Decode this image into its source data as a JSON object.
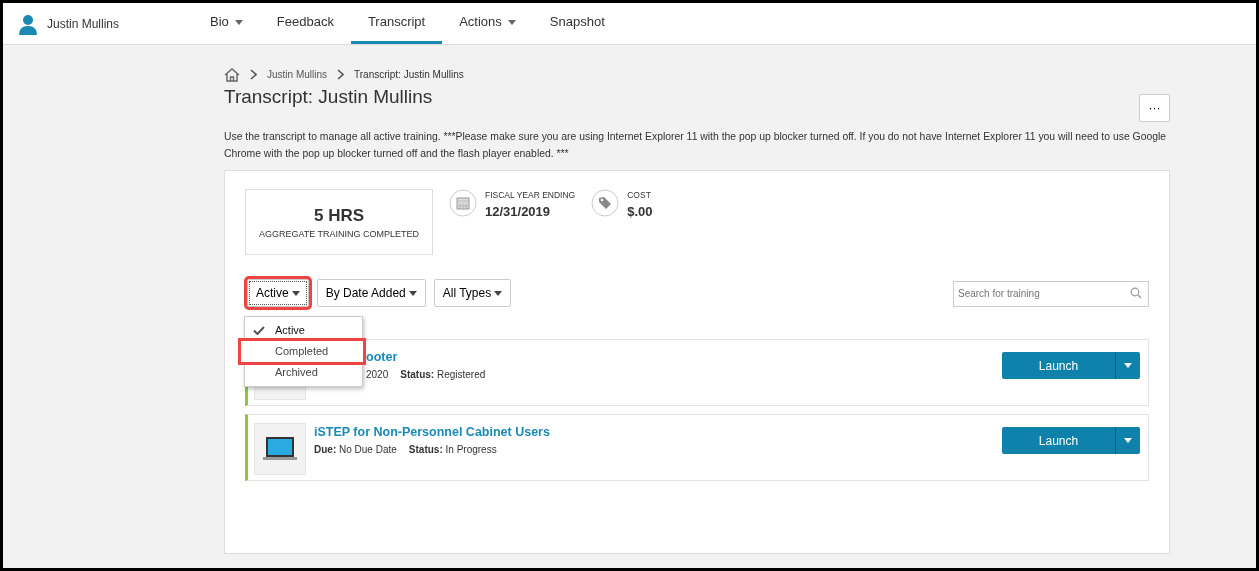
{
  "user": {
    "name": "Justin Mullins"
  },
  "nav": [
    {
      "label": "Bio",
      "dropdown": true,
      "selected": false
    },
    {
      "label": "Feedback",
      "dropdown": false,
      "selected": false
    },
    {
      "label": "Transcript",
      "dropdown": false,
      "selected": true
    },
    {
      "label": "Actions",
      "dropdown": true,
      "selected": false
    },
    {
      "label": "Snapshot",
      "dropdown": false,
      "selected": false
    }
  ],
  "breadcrumb": [
    "Justin Mullins",
    "Transcript: Justin Mullins"
  ],
  "title": "Transcript: Justin Mullins",
  "more_button": "···",
  "description": "Use the transcript to manage all active training. ***Please make sure you are using Internet Explorer 11 with the pop up blocker turned off. If you do not have Internet Explorer 11 you will need to use Google Chrome with the pop up blocker turned off and the flash player enabled. ***",
  "summary": {
    "value": "5 HRS",
    "label": "AGGREGATE TRAINING COMPLETED"
  },
  "stats": [
    {
      "kind": "calendar",
      "label": "FISCAL YEAR ENDING",
      "value": "12/31/2019"
    },
    {
      "kind": "tag",
      "label": "COST",
      "value": "$.00"
    }
  ],
  "filters": [
    {
      "label": "Active",
      "open": true,
      "annotated": true
    },
    {
      "label": "By Date Added",
      "open": false,
      "annotated": false
    },
    {
      "label": "All Types",
      "open": false,
      "annotated": false
    }
  ],
  "status_menu": [
    {
      "label": "Active",
      "selected": true,
      "annotated": false
    },
    {
      "label": "Completed",
      "selected": false,
      "annotated": true
    },
    {
      "label": "Archived",
      "selected": false,
      "annotated": false
    }
  ],
  "search": {
    "placeholder": "Search for training"
  },
  "trainings": [
    {
      "kind": "partly_hidden",
      "title": "ooter",
      "due": "2020",
      "status": "**Status:** Registered",
      "button": "Launch"
    },
    {
      "kind": "full",
      "title": "iSTEP for Non-Personnel Cabinet Users",
      "due": "**Due:** No Due Date",
      "status": "**Status:** In Progress",
      "button": "Launch"
    }
  ]
}
